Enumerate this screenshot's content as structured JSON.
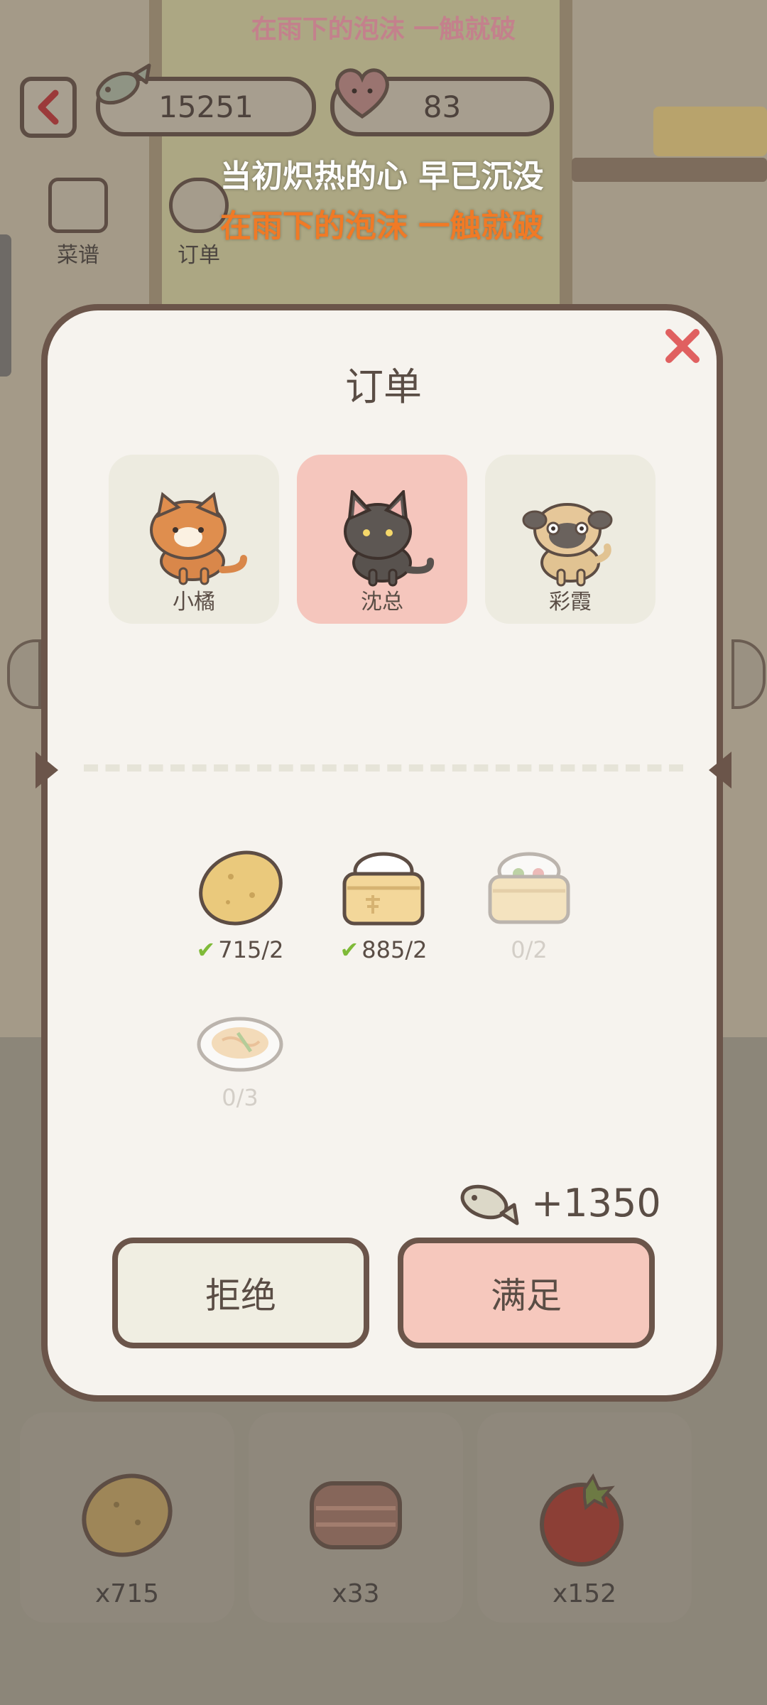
{
  "song_banner": "在雨下的泡沫 一触就破",
  "hud": {
    "fish_count": "15251",
    "heart_count": "83"
  },
  "menu": {
    "recipes_label": "菜谱",
    "orders_label": "订单"
  },
  "lyrics": {
    "line1": "当初炽热的心 早已沉没",
    "line2": "在雨下的泡沫 一触就破"
  },
  "modal": {
    "title": "订单",
    "customers": [
      {
        "name": "小橘",
        "selected": false
      },
      {
        "name": "沈总",
        "selected": true
      },
      {
        "name": "彩霞",
        "selected": false
      }
    ],
    "requirements": [
      {
        "item": "potato-icon",
        "count": "715/2",
        "done": true
      },
      {
        "item": "rice-steamer-icon",
        "count": "885/2",
        "done": true
      },
      {
        "item": "dumpling-steamer-icon",
        "count": "0/2",
        "done": false
      },
      {
        "item": "noodle-plate-icon",
        "count": "0/3",
        "done": false
      }
    ],
    "reward": "+1350",
    "reject_label": "拒绝",
    "accept_label": "满足"
  },
  "inventory": [
    {
      "item": "potato-icon",
      "qty": "x715"
    },
    {
      "item": "meat-icon",
      "qty": "x33"
    },
    {
      "item": "tomato-icon",
      "qty": "x152"
    }
  ],
  "colors": {
    "accent": "#f6c8bd",
    "border": "#6b554a",
    "check": "#7fba38",
    "lyric_orange": "#f07a26"
  }
}
